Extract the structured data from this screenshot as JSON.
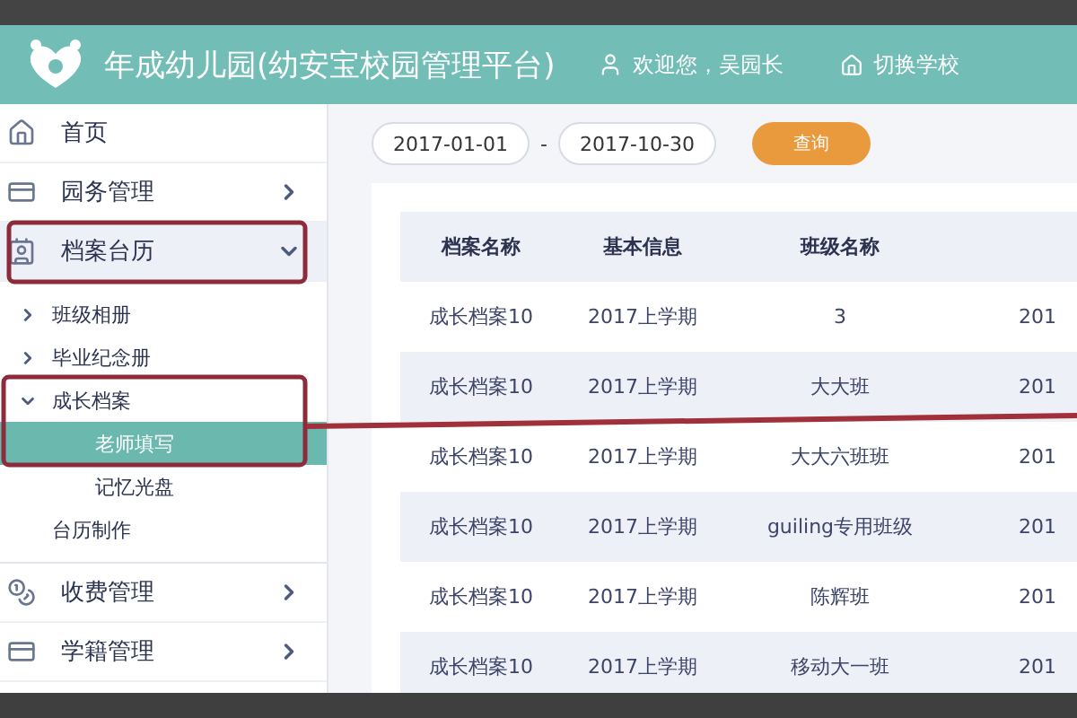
{
  "header": {
    "title": "年成幼儿园(幼安宝校园管理平台)",
    "user": "欢迎您，吴园长",
    "switch_school": "切换学校"
  },
  "sidebar": {
    "items": [
      {
        "label": "首页",
        "selected": false
      },
      {
        "label": "园务管理",
        "selected": false,
        "expanded": false
      },
      {
        "label": "档案台历",
        "selected": true,
        "expanded": true,
        "children": [
          {
            "label": "班级相册",
            "expanded": false
          },
          {
            "label": "毕业纪念册",
            "expanded": false
          },
          {
            "label": "成长档案",
            "expanded": true,
            "children": [
              {
                "label": "老师填写",
                "selected": true
              },
              {
                "label": "记忆光盘",
                "selected": false
              }
            ]
          },
          {
            "label": "台历制作"
          }
        ]
      },
      {
        "label": "收费管理",
        "selected": false,
        "expanded": false
      },
      {
        "label": "学籍管理",
        "selected": false,
        "expanded": false
      }
    ]
  },
  "filter": {
    "start_date": "2017-01-01",
    "separator": "-",
    "end_date": "2017-10-30",
    "query_button": "查询"
  },
  "table": {
    "columns": [
      "档案名称",
      "基本信息",
      "班级名称"
    ],
    "rows": [
      [
        "成长档案10",
        "2017上学期",
        "3",
        "201"
      ],
      [
        "成长档案10",
        "2017上学期",
        "大大班",
        "201"
      ],
      [
        "成长档案10",
        "2017上学期",
        "大大六班班",
        "201"
      ],
      [
        "成长档案10",
        "2017上学期",
        "guiling专用班级",
        "201"
      ],
      [
        "成长档案10",
        "2017上学期",
        "陈辉班",
        "201"
      ],
      [
        "成长档案10",
        "2017上学期",
        "移动大一班",
        "201"
      ]
    ]
  },
  "annotations": [
    {
      "kind": "frame"
    },
    {
      "kind": "frame"
    },
    {
      "kind": "line"
    }
  ]
}
